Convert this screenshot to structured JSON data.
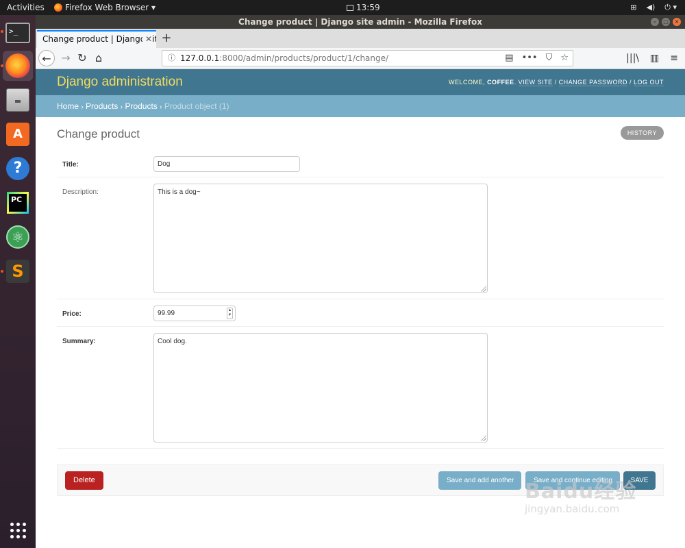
{
  "topbar": {
    "activities": "Activities",
    "app_menu": "Firefox Web Browser ▾",
    "clock": "13:59",
    "sys_icons": [
      "network-icon",
      "volume-icon",
      "power-icon"
    ]
  },
  "dock": {
    "apps": [
      "terminal",
      "firefox",
      "files",
      "software-center",
      "help",
      "pycharm",
      "atom",
      "sublime-text",
      "show-applications"
    ],
    "store_glyph": "A",
    "help_glyph": "?",
    "pycharm_glyph": "PC",
    "atom_glyph": "⚛",
    "sublime_glyph": "S",
    "terminal_glyph": ">_"
  },
  "window": {
    "title": "Change product | Django site admin - Mozilla Firefox"
  },
  "browser": {
    "tab_title": "Change product | Django site admin",
    "new_tab": "+",
    "url_host": "127.0.0.1",
    "url_rest": ":8000/admin/products/product/1/change/",
    "back": "←",
    "forward": "→",
    "reload": "↻",
    "home": "⌂",
    "url_more": "•••",
    "bookmark": "☆",
    "reader": "▤",
    "pocket": "⛉",
    "library": "|||\\",
    "sidebar": "▥",
    "menu": "≡"
  },
  "django": {
    "branding": "Django administration",
    "welcome": "WELCOME,",
    "username": "COFFEE",
    "view_site": "VIEW SITE",
    "change_password": "CHANGE PASSWORD",
    "log_out": "LOG OUT",
    "breadcrumbs": {
      "home": "Home",
      "app": "Products",
      "model": "Products",
      "current": "Product object (1)"
    },
    "title": "Change product",
    "history": "HISTORY",
    "fields": {
      "title_label": "Title:",
      "title_value": "Dog",
      "description_label": "Description:",
      "description_value": "This is a dog~",
      "price_label": "Price:",
      "price_value": "99.99",
      "summary_label": "Summary:",
      "summary_value": "Cool dog."
    },
    "buttons": {
      "delete": "Delete",
      "save_add_another": "Save and add another",
      "save_continue": "Save and continue editing",
      "save": "SAVE"
    }
  },
  "watermark": {
    "logo": "Baidu经验",
    "url": "jingyan.baidu.com"
  }
}
